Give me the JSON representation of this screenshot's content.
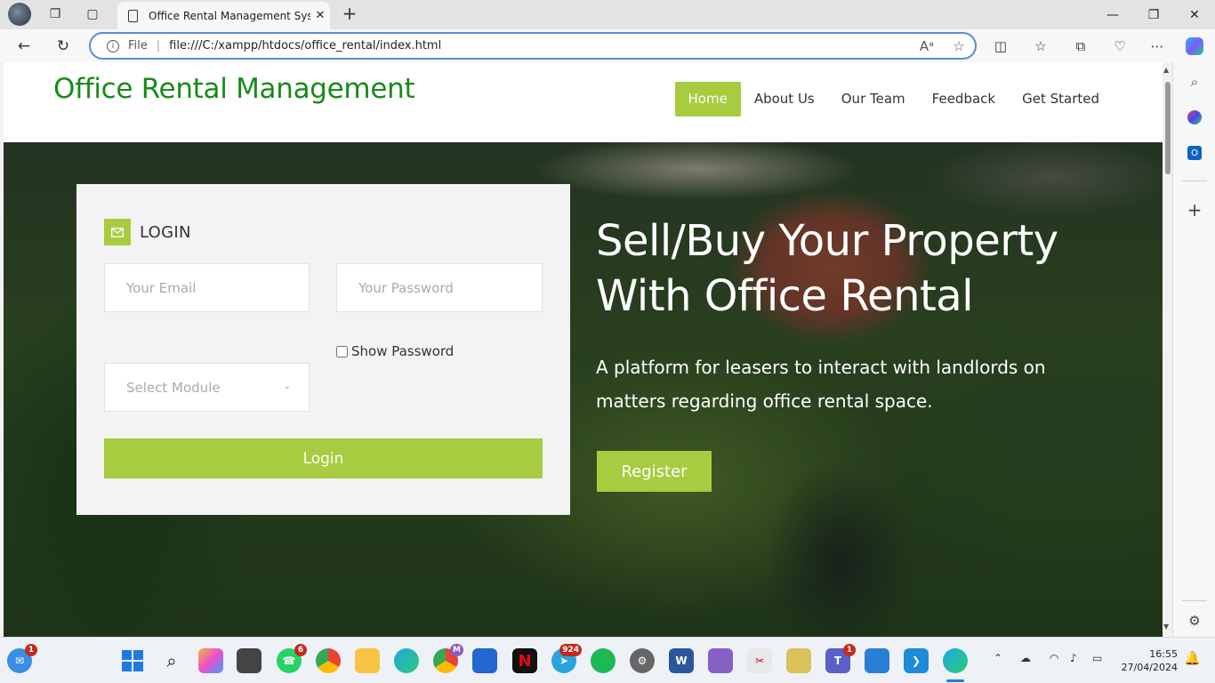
{
  "browser": {
    "tab_title": "Office Rental Management Syste",
    "address_scheme": "File",
    "url": "file:///C:/xampp/htdocs/office_rental/index.html"
  },
  "site": {
    "brand": "Office Rental Management",
    "nav": [
      {
        "label": "Home",
        "active": true
      },
      {
        "label": "About Us"
      },
      {
        "label": "Our Team"
      },
      {
        "label": "Feedback"
      },
      {
        "label": "Get Started"
      }
    ]
  },
  "login": {
    "title": "LOGIN",
    "email_placeholder": "Your Email",
    "password_placeholder": "Your Password",
    "show_password_label": "Show Password",
    "module_placeholder": "Select Module",
    "button": "Login"
  },
  "hero": {
    "title_line1": "Sell/Buy Your Property",
    "title_line2": "With Office Rental",
    "subtitle": "A platform for leasers to interact with landlords on matters regarding office rental space.",
    "register_button": "Register"
  },
  "taskbar": {
    "badges": {
      "mail": "1",
      "whatsapp": "6",
      "chrome2": "M",
      "telegram": "924",
      "teams": "1"
    },
    "time": "16:55",
    "date": "27/04/2024"
  },
  "colors": {
    "accent": "#a8cc3f",
    "brand": "#1a8a1a"
  }
}
